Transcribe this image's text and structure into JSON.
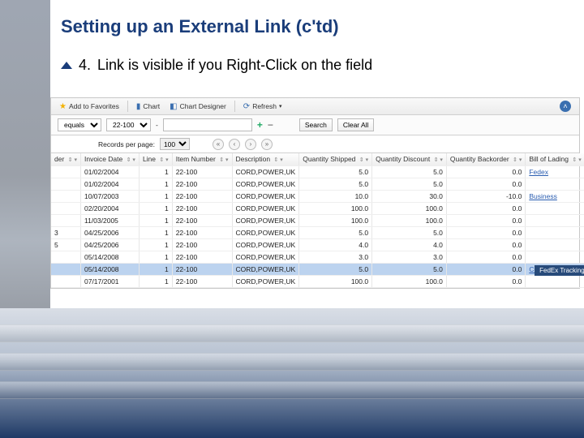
{
  "title": "Setting up an External Link (c'td)",
  "bullet": {
    "number": "4.",
    "text": "Link is visible if you Right-Click on the field"
  },
  "toolbar": {
    "add_favorites": "Add to Favorites",
    "chart": "Chart",
    "chart_designer": "Chart Designer",
    "refresh": "Refresh"
  },
  "filter": {
    "equals": "equals",
    "item_value": "22-100",
    "dash": "-",
    "search": "Search",
    "clear": "Clear All"
  },
  "pager": {
    "label": "Records per page:",
    "value": "100"
  },
  "columns": [
    "der",
    "Invoice Date",
    "Line",
    "Item Number",
    "Description",
    "Quantity Shipped",
    "Quantity Discount",
    "Quantity Backorder",
    "Bill of Lading"
  ],
  "rows": [
    {
      "der": "",
      "date": "01/02/2004",
      "line": "1",
      "item": "22-100",
      "desc": "CORD,POWER,UK",
      "ship": "5.0",
      "disc": "5.0",
      "back": "0.0",
      "bol": "Fedex"
    },
    {
      "der": "",
      "date": "01/02/2004",
      "line": "1",
      "item": "22-100",
      "desc": "CORD,POWER,UK",
      "ship": "5.0",
      "disc": "5.0",
      "back": "0.0",
      "bol": ""
    },
    {
      "der": "",
      "date": "10/07/2003",
      "line": "1",
      "item": "22-100",
      "desc": "CORD,POWER,UK",
      "ship": "10.0",
      "disc": "30.0",
      "back": "-10.0",
      "bol": "Business"
    },
    {
      "der": "",
      "date": "02/20/2004",
      "line": "1",
      "item": "22-100",
      "desc": "CORD,POWER,UK",
      "ship": "100.0",
      "disc": "100.0",
      "back": "0.0",
      "bol": ""
    },
    {
      "der": "",
      "date": "11/03/2005",
      "line": "1",
      "item": "22-100",
      "desc": "CORD,POWER,UK",
      "ship": "100.0",
      "disc": "100.0",
      "back": "0.0",
      "bol": ""
    },
    {
      "der": "3",
      "date": "04/25/2006",
      "line": "1",
      "item": "22-100",
      "desc": "CORD,POWER,UK",
      "ship": "5.0",
      "disc": "5.0",
      "back": "0.0",
      "bol": ""
    },
    {
      "der": "5",
      "date": "04/25/2006",
      "line": "1",
      "item": "22-100",
      "desc": "CORD,POWER,UK",
      "ship": "4.0",
      "disc": "4.0",
      "back": "0.0",
      "bol": ""
    },
    {
      "der": "",
      "date": "05/14/2008",
      "line": "1",
      "item": "22-100",
      "desc": "CORD,POWER,UK",
      "ship": "3.0",
      "disc": "3.0",
      "back": "0.0",
      "bol": ""
    },
    {
      "der": "",
      "date": "05/14/2008",
      "line": "1",
      "item": "22-100",
      "desc": "CORD,POWER,UK",
      "ship": "5.0",
      "disc": "5.0",
      "back": "0.0",
      "bol": "CCF"
    },
    {
      "der": "",
      "date": "07/17/2001",
      "line": "1",
      "item": "22-100",
      "desc": "CORD,POWER,UK",
      "ship": "100.0",
      "disc": "100.0",
      "back": "0.0",
      "bol": ""
    }
  ],
  "context_menu": "FedEx Tracking",
  "selected_row_index": 8
}
